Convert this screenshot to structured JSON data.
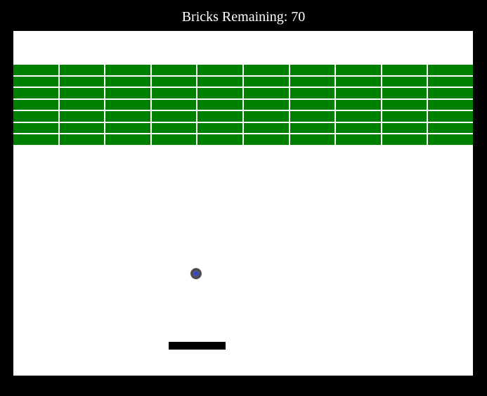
{
  "hud": {
    "bricks_label": "Bricks Remaining: 70",
    "bricks_remaining": 70
  },
  "bricks": {
    "rows": 7,
    "cols": 10,
    "color": "#008000",
    "mortar_color": "#ffffff"
  },
  "colors": {
    "background": "#000000",
    "playfield": "#ffffff",
    "paddle": "#000000",
    "ball_core": "#3a46c8",
    "ball_ring": "#3a3a3a",
    "hud_text": "#ffffff"
  }
}
